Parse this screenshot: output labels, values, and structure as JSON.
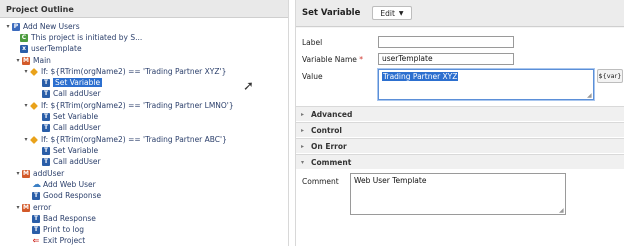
{
  "outline": {
    "title": "Project Outline",
    "nodes": [
      {
        "label": "Add New Users",
        "icon": "project-icon"
      },
      {
        "label": "This project is initiated by S...",
        "icon": "comment-icon"
      },
      {
        "label": "userTemplate",
        "icon": "variable-icon"
      },
      {
        "label": "Main",
        "icon": "process-icon"
      },
      {
        "label": "If: ${RTrim(orgName2) == 'Trading Partner XYZ'}",
        "icon": "condition-icon"
      },
      {
        "label": "Set Variable",
        "icon": "task-icon"
      },
      {
        "label": "Call addUser",
        "icon": "task-icon"
      },
      {
        "label": "If: ${RTrim(orgName2) == 'Trading Partner LMNO'}",
        "icon": "condition-icon"
      },
      {
        "label": "Set Variable",
        "icon": "task-icon"
      },
      {
        "label": "Call addUser",
        "icon": "task-icon"
      },
      {
        "label": "If: ${RTrim(orgName2) == 'Trading Partner ABC'}",
        "icon": "condition-icon"
      },
      {
        "label": "Set Variable",
        "icon": "task-icon"
      },
      {
        "label": "Call addUser",
        "icon": "task-icon"
      },
      {
        "label": "addUser",
        "icon": "process-icon"
      },
      {
        "label": "Add Web User",
        "icon": "cloud-icon"
      },
      {
        "label": "Good Response",
        "icon": "task-icon"
      },
      {
        "label": "error",
        "icon": "process-icon"
      },
      {
        "label": "Bad Response",
        "icon": "task-icon"
      },
      {
        "label": "Print to log",
        "icon": "task-icon"
      },
      {
        "label": "Exit Project",
        "icon": "exit-icon"
      }
    ]
  },
  "props": {
    "title": "Set Variable",
    "edit_label": "Edit",
    "label_field": {
      "label": "Label",
      "value": ""
    },
    "variable_name": {
      "label": "Variable Name",
      "value": "userTemplate"
    },
    "value_field": {
      "label": "Value",
      "value": "Trading Partner XYZ"
    },
    "var_button": "${var}",
    "sections": [
      "Advanced",
      "Control",
      "On Error",
      "Comment"
    ],
    "comment": {
      "label": "Comment",
      "value": "Web User Template"
    }
  },
  "colors": {
    "selection": "#2c6fcf",
    "required": "#d0342c"
  }
}
